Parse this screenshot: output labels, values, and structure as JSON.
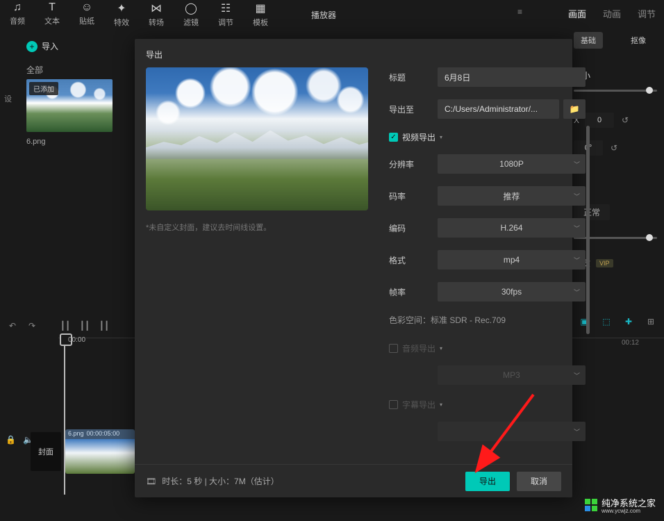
{
  "toolbar": {
    "items": [
      {
        "label": "音频"
      },
      {
        "label": "文本"
      },
      {
        "label": "贴纸"
      },
      {
        "label": "特效"
      },
      {
        "label": "转场"
      },
      {
        "label": "滤镜"
      },
      {
        "label": "调节"
      },
      {
        "label": "模板"
      }
    ]
  },
  "player": {
    "title": "播放器"
  },
  "right_tabs": {
    "tab1": "画面",
    "tab2": "动画",
    "tab3": "调节"
  },
  "import": {
    "label": "导入"
  },
  "library": {
    "all": "全部"
  },
  "media": {
    "badge": "已添加",
    "filename": "6.png"
  },
  "modal": {
    "title": "导出",
    "preview_hint": "*未自定义封面，建议去时间线设置。",
    "labels": {
      "title": "标题",
      "export_to": "导出至",
      "resolution": "分辨率",
      "bitrate": "码率",
      "codec": "编码",
      "format": "格式",
      "fps": "帧率"
    },
    "values": {
      "title": "6月8日",
      "export_path": "C:/Users/Administrator/...",
      "resolution": "1080P",
      "bitrate": "推荐",
      "codec": "H.264",
      "format": "mp4",
      "fps": "30fps",
      "audio_format": "MP3"
    },
    "sections": {
      "video": "视频导出",
      "audio": "音频导出",
      "subtitle": "字幕导出"
    },
    "color_space_label": "色彩空间：",
    "color_space_value": "标准 SDR - Rec.709",
    "footer_info": "时长：5 秒 | 大小：7M（估计）",
    "export_btn": "导出",
    "cancel_btn": "取消"
  },
  "right_panel": {
    "pill1": "基础",
    "pill2": "抠像",
    "size_label": "大小",
    "x_label": "X",
    "x_value": "0",
    "deg_value": "0°",
    "mode_value": "正常",
    "quality_label": "画质",
    "vip": "VIP"
  },
  "timeline": {
    "playhead_time": "00:00",
    "ruler_mark": "00:12",
    "cover": "封面",
    "clip_name": "6.png",
    "clip_duration": "00:00:05:00"
  },
  "side_tab": "设",
  "watermark": {
    "main": "纯净系统之家",
    "sub": "www.ycwjz.com"
  }
}
